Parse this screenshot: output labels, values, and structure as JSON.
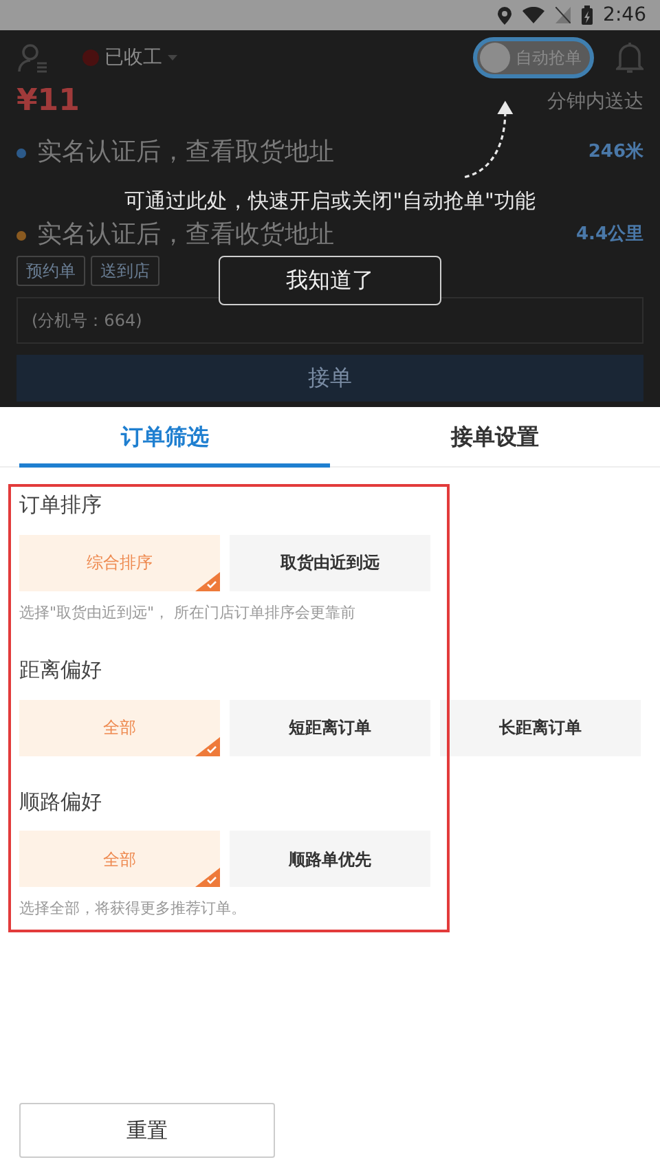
{
  "status_bar": {
    "time": "2:46"
  },
  "header": {
    "work_status": "已收工",
    "auto_grab": {
      "label": "自动抢单",
      "on": false
    }
  },
  "order": {
    "price": "¥11",
    "delivery_time": "分钟内送达",
    "stops": [
      {
        "kind": "pickup",
        "address": "实名认证后，查看取货地址",
        "distance": "246米"
      },
      {
        "kind": "dropoff",
        "address": "实名认证后，查看收货地址",
        "distance": "4.4公里"
      }
    ],
    "tags": [
      "预约单",
      "送到店"
    ],
    "extension": "(分机号：664)",
    "accept_button": "接单"
  },
  "guide": {
    "message": "可通过此处，快速开启或关闭\"自动抢单\"功能",
    "button": "我知道了"
  },
  "tabs": [
    {
      "label": "订单筛选",
      "selected": true
    },
    {
      "label": "接单设置",
      "selected": false
    }
  ],
  "sections": [
    {
      "title": "订单排序",
      "options": [
        {
          "label": "综合排序",
          "selected": true
        },
        {
          "label": "取货由近到远",
          "selected": false
        }
      ],
      "hint": "选择\"取货由近到远\"， 所在门店订单排序会更靠前"
    },
    {
      "title": "距离偏好",
      "options": [
        {
          "label": "全部",
          "selected": true
        },
        {
          "label": "短距离订单",
          "selected": false
        },
        {
          "label": "长距离订单",
          "selected": false
        }
      ]
    },
    {
      "title": "顺路偏好",
      "options": [
        {
          "label": "全部",
          "selected": true
        },
        {
          "label": "顺路单优先",
          "selected": false
        }
      ],
      "hint": "选择全部，将获得更多推荐订单。"
    }
  ],
  "footer": {
    "reset_button": "重置"
  }
}
